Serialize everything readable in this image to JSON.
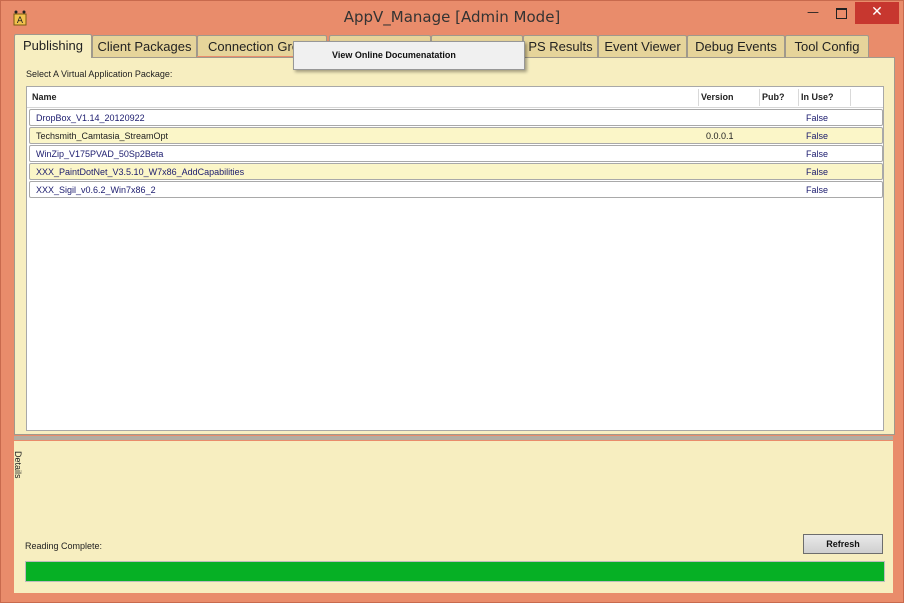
{
  "window": {
    "title": "AppV_Manage [Admin Mode]",
    "min_glyph": "—",
    "close_glyph": "✕"
  },
  "tabs": [
    {
      "label": "Publishing",
      "active": true
    },
    {
      "label": "Client Packages"
    },
    {
      "label": "Connection Gro"
    },
    {
      "label": ""
    },
    {
      "label": ""
    },
    {
      "label": "PS Results"
    },
    {
      "label": "Event Viewer"
    },
    {
      "label": "Debug Events"
    },
    {
      "label": "Tool Config"
    }
  ],
  "context_menu": {
    "items": [
      "View Online Documenatation"
    ]
  },
  "publishing": {
    "select_label": "Select A Virtual Application Package:",
    "columns": {
      "name": "Name",
      "version": "Version",
      "pub": "Pub?",
      "in_use": "In Use?"
    },
    "rows": [
      {
        "name": "DropBox_V1.14_20120922",
        "version": "",
        "pub": "",
        "in_use": "False"
      },
      {
        "name": "Techsmith_Camtasia_StreamOpt",
        "version": "0.0.0.1",
        "pub": "",
        "in_use": "False"
      },
      {
        "name": "WinZip_V175PVAD_50Sp2Beta",
        "version": "",
        "pub": "",
        "in_use": "False"
      },
      {
        "name": "XXX_PaintDotNet_V3.5.10_W7x86_AddCapabilities",
        "version": "",
        "pub": "",
        "in_use": "False"
      },
      {
        "name": "XXX_Sigil_v0.6.2_Win7x86_2",
        "version": "",
        "pub": "",
        "in_use": "False"
      }
    ]
  },
  "details": {
    "label": "Details"
  },
  "status": {
    "text": "Reading Complete:",
    "refresh_label": "Refresh",
    "progress": 1.0,
    "progress_color": "#06b025"
  },
  "colors": {
    "frame": "#e98c6b",
    "panel": "#f7eec0",
    "tab": "#e6d49a",
    "close": "#c7372f"
  }
}
